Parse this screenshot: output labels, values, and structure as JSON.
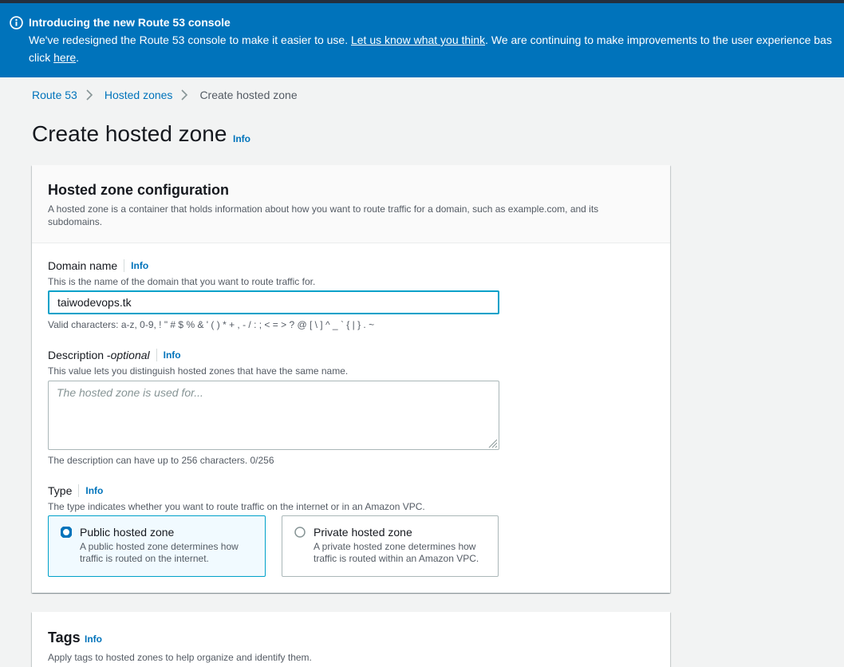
{
  "banner": {
    "title": "Introducing the new Route 53 console",
    "line1_prefix": "We've redesigned the Route 53 console to make it easier to use. ",
    "line1_link": "Let us know what you think",
    "line1_suffix": ". We are continuing to make improvements to the user experience bas",
    "line2_prefix": "click ",
    "line2_link": "here",
    "line2_suffix": ".",
    "icon": "info-circle-icon"
  },
  "breadcrumb": {
    "items": [
      "Route 53",
      "Hosted zones"
    ],
    "current": "Create hosted zone"
  },
  "page": {
    "title": "Create hosted zone",
    "info": "Info"
  },
  "config": {
    "title": "Hosted zone configuration",
    "description": "A hosted zone is a container that holds information about how you want to route traffic for a domain, such as example.com, and its subdomains.",
    "domain": {
      "label": "Domain name",
      "info": "Info",
      "hint": "This is the name of the domain that you want to route traffic for.",
      "value": "taiwodevops.tk",
      "constraint": "Valid characters: a-z, 0-9, ! \" # $ % & ' ( ) * + , - / : ; < = > ? @ [ \\ ] ^ _ ` { | } . ~"
    },
    "description_field": {
      "label": "Description - ",
      "label_optional": "optional",
      "info": "Info",
      "hint": "This value lets you distinguish hosted zones that have the same name.",
      "placeholder": "The hosted zone is used for...",
      "constraint": "The description can have up to 256 characters. 0/256"
    },
    "type": {
      "label": "Type",
      "info": "Info",
      "hint": "The type indicates whether you want to route traffic on the internet or in an Amazon VPC.",
      "options": [
        {
          "title": "Public hosted zone",
          "description": "A public hosted zone determines how traffic is routed on the internet.",
          "selected": true
        },
        {
          "title": "Private hosted zone",
          "description": "A private hosted zone determines how traffic is routed within an Amazon VPC.",
          "selected": false
        }
      ]
    }
  },
  "tags": {
    "title": "Tags",
    "info": "Info",
    "description": "Apply tags to hosted zones to help organize and identify them."
  },
  "colors": {
    "banner": "#0073bb",
    "link": "#0073bb",
    "focus": "#00a1c9"
  }
}
